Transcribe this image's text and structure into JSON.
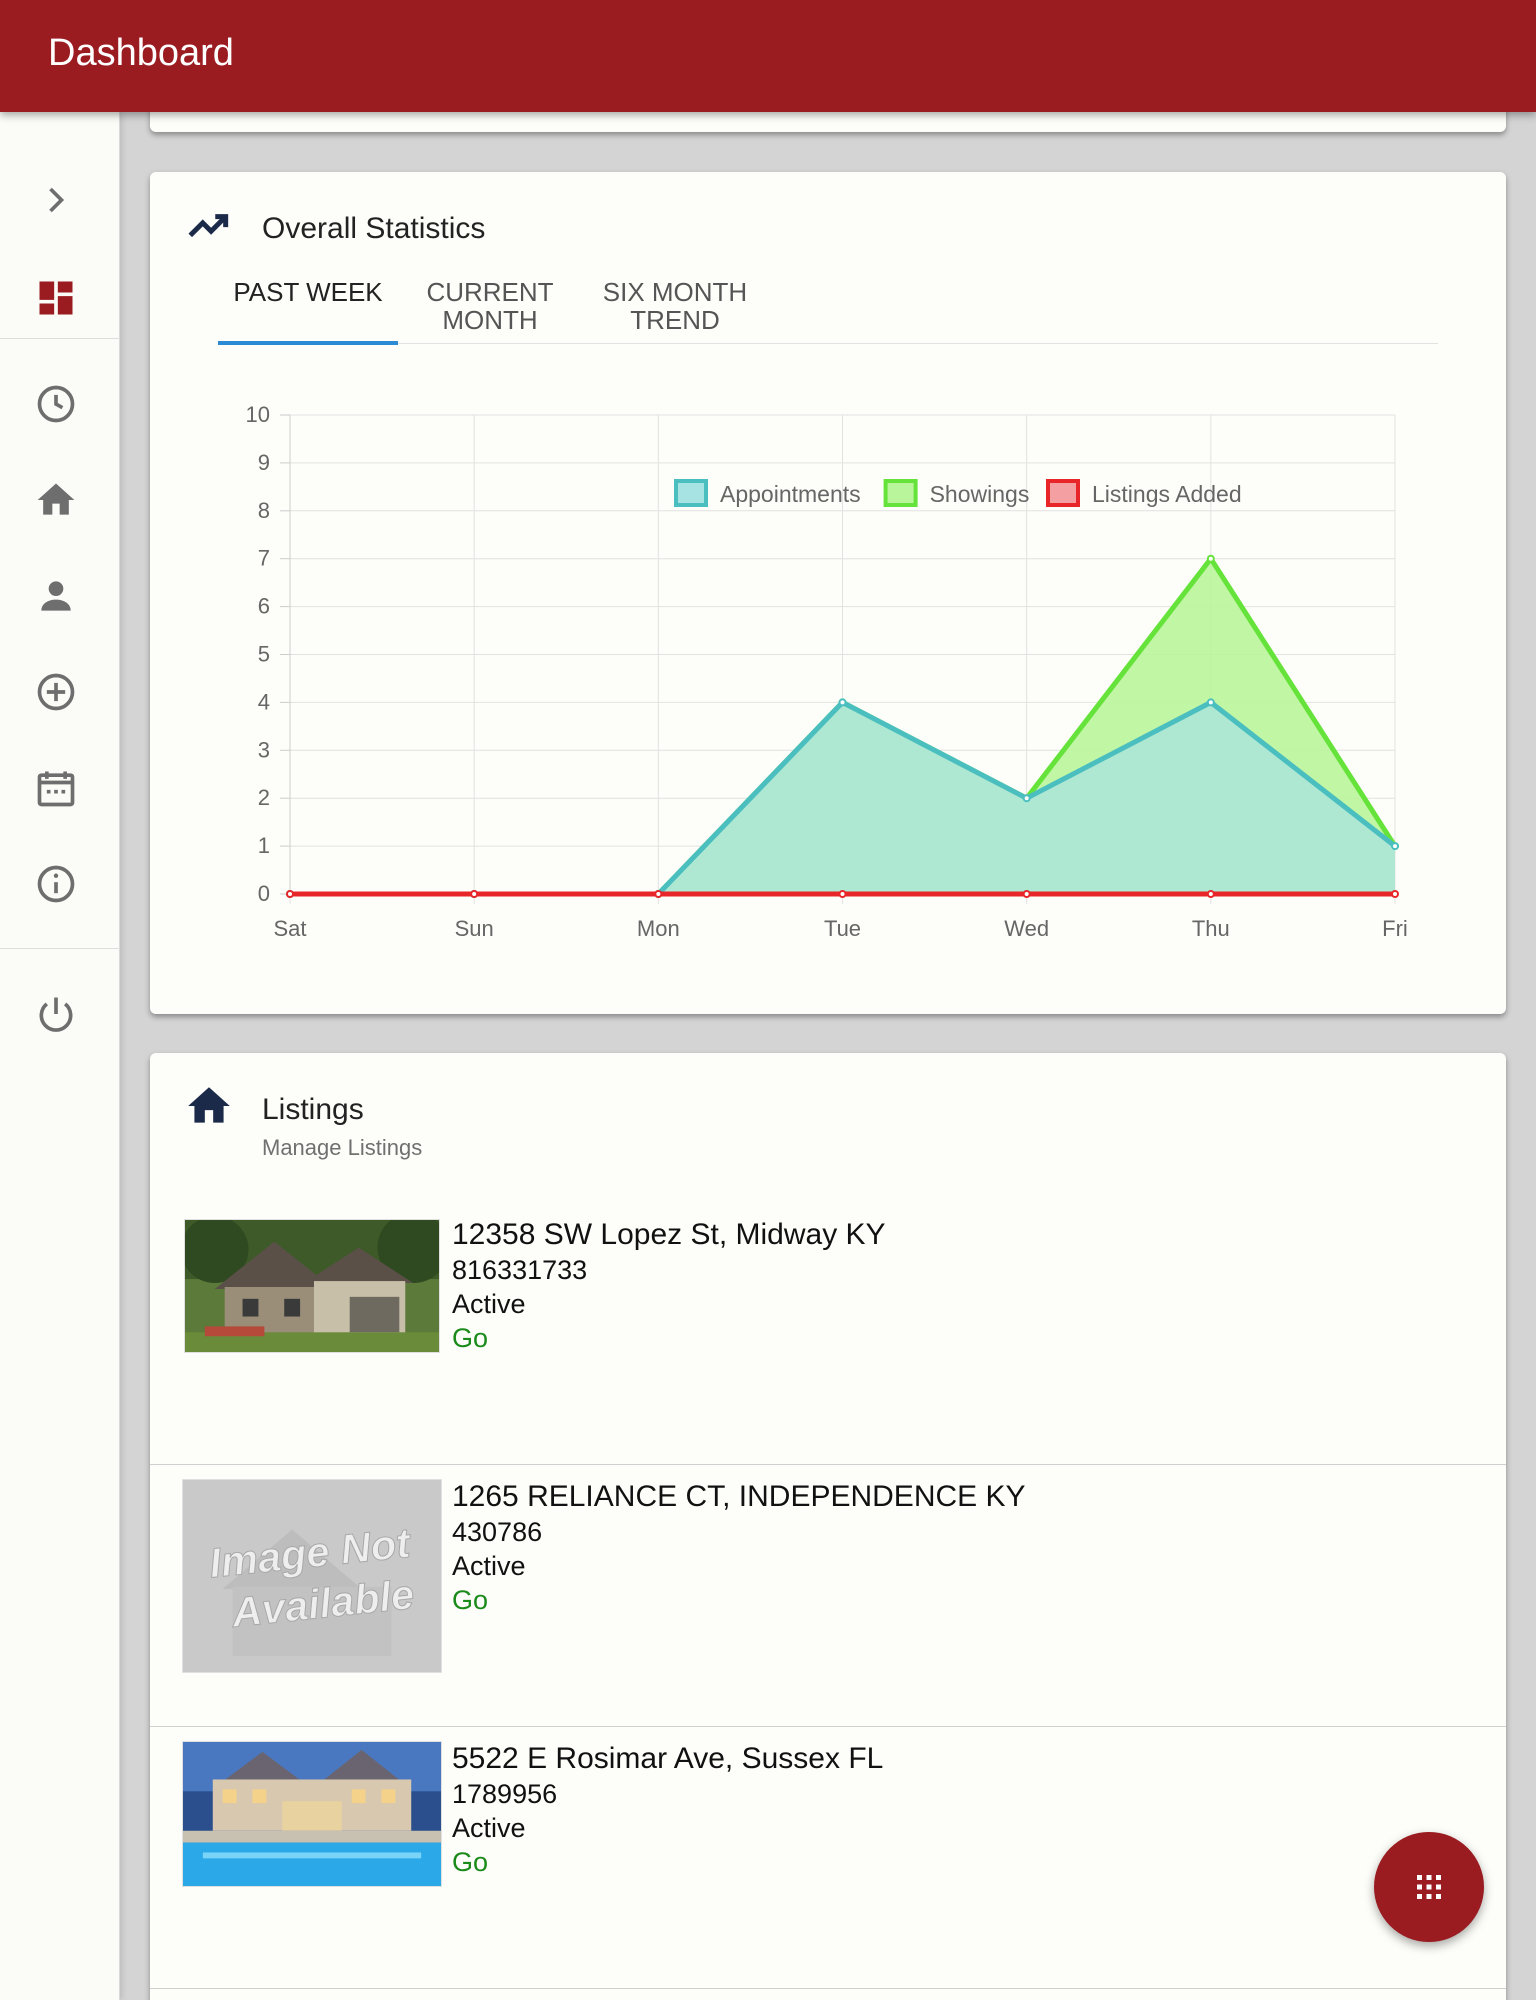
{
  "app": {
    "title": "Dashboard"
  },
  "sidenav": {
    "items": [
      {
        "name": "expand",
        "icon": "chevron-right-icon"
      },
      {
        "name": "dashboard",
        "icon": "dashboard-icon",
        "active": true
      },
      {
        "name": "recent",
        "icon": "clock-icon"
      },
      {
        "name": "listings",
        "icon": "home-icon"
      },
      {
        "name": "contacts",
        "icon": "person-icon"
      },
      {
        "name": "add",
        "icon": "add-circle-icon"
      },
      {
        "name": "calendar",
        "icon": "calendar-icon"
      },
      {
        "name": "info",
        "icon": "info-icon"
      },
      {
        "name": "logout",
        "icon": "power-icon"
      }
    ],
    "active_color": "#9a1b20",
    "icon_color": "#6e6e6e"
  },
  "stats": {
    "title": "Overall Statistics",
    "icon": "trending-up-icon",
    "tabs": [
      {
        "line1": "PAST WEEK",
        "line2": "",
        "active": true
      },
      {
        "line1": "CURRENT",
        "line2": "MONTH",
        "active": false
      },
      {
        "line1": "SIX MONTH",
        "line2": "TREND",
        "active": false
      }
    ]
  },
  "chart_data": {
    "type": "area",
    "categories": [
      "Sat",
      "Sun",
      "Mon",
      "Tue",
      "Wed",
      "Thu",
      "Fri"
    ],
    "ylim": [
      0,
      10
    ],
    "yticks": [
      0,
      1,
      2,
      3,
      4,
      5,
      6,
      7,
      8,
      9,
      10
    ],
    "grid": true,
    "legend": "top-center",
    "series": [
      {
        "name": "Appointments",
        "values": [
          0,
          0,
          0,
          4,
          2,
          4,
          1
        ],
        "stroke": "#4bbfc0",
        "fill": "#a8e3e3"
      },
      {
        "name": "Showings",
        "values": [
          0,
          0,
          0,
          4,
          2,
          7,
          1
        ],
        "stroke": "#66e33a",
        "fill": "#b9f59a"
      },
      {
        "name": "Listings Added",
        "values": [
          0,
          0,
          0,
          0,
          0,
          0,
          0
        ],
        "stroke": "#e8262a",
        "fill": "#f4a0a2"
      }
    ]
  },
  "listings": {
    "title": "Listings",
    "subtitle": "Manage Listings",
    "icon": "home-icon",
    "items": [
      {
        "address": "12358 SW Lopez St, Midway KY",
        "mls": "816331733",
        "status": "Active",
        "action": "Go",
        "image": "house-photo"
      },
      {
        "address": "1265 RELIANCE CT, INDEPENDENCE KY",
        "mls": "430786",
        "status": "Active",
        "action": "Go",
        "image": "image-not-available",
        "placeholder_text_1": "Image Not",
        "placeholder_text_2": "Available"
      },
      {
        "address": "5522 E Rosimar Ave, Sussex FL",
        "mls": "1789956",
        "status": "Active",
        "action": "Go",
        "image": "mansion-pool-photo"
      }
    ]
  },
  "fab": {
    "icon": "apps-grid-icon"
  }
}
